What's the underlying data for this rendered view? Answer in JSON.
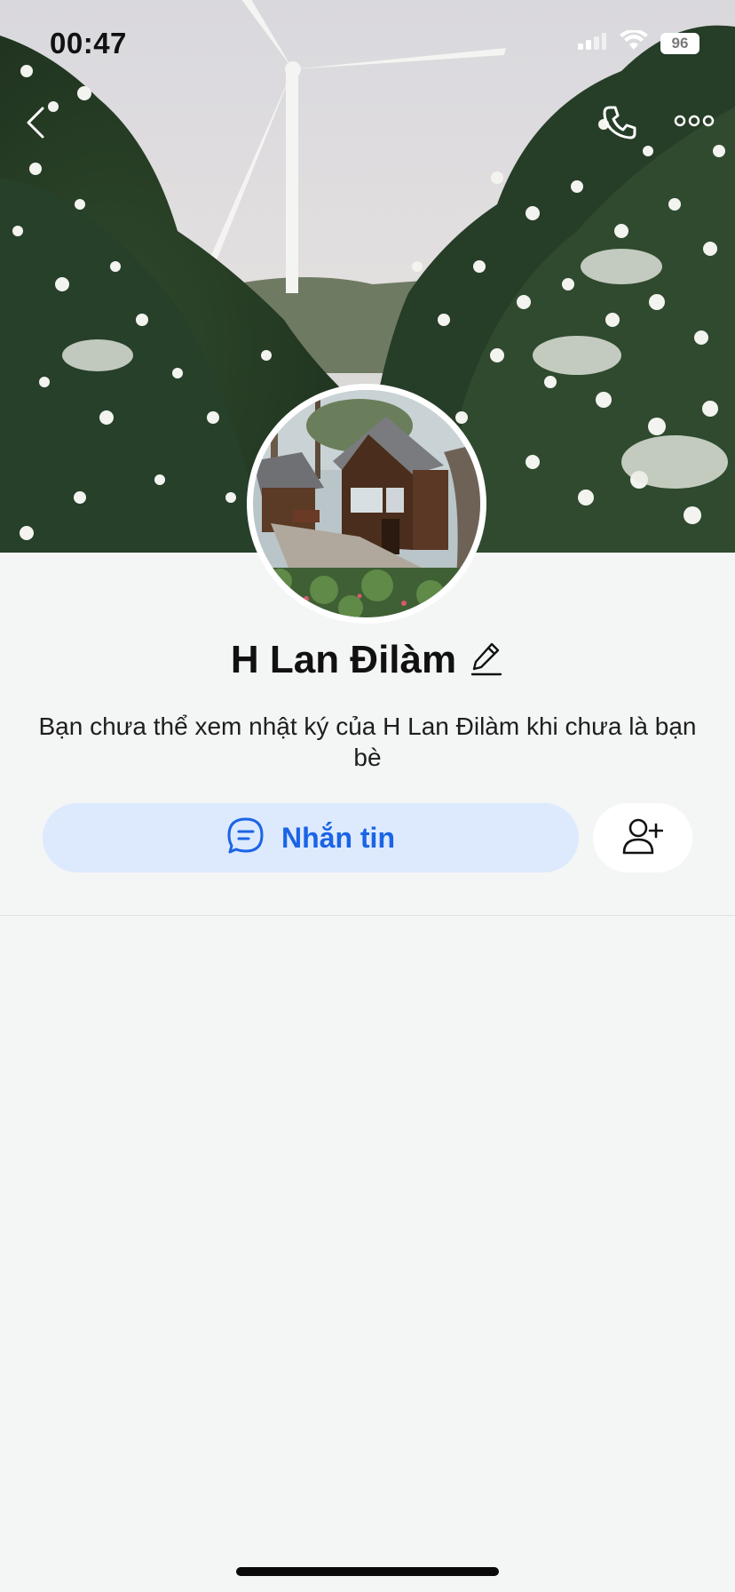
{
  "status_bar": {
    "time": "00:47",
    "battery": "96"
  },
  "profile": {
    "name": "H Lan Đilàm",
    "notice": "Bạn chưa thể xem nhật ký của H Lan Đilàm khi chưa là bạn bè"
  },
  "actions": {
    "message_label": "Nhắn tin"
  },
  "icons": {
    "back": "chevron-left-icon",
    "call": "phone-icon",
    "more": "more-dots-icon",
    "edit": "pencil-icon",
    "message": "chat-bubble-icon",
    "add_friend": "add-user-icon"
  },
  "colors": {
    "accent": "#1a64e6",
    "message_button_bg": "#dde9fd",
    "page_bg": "#f4f5f5"
  }
}
